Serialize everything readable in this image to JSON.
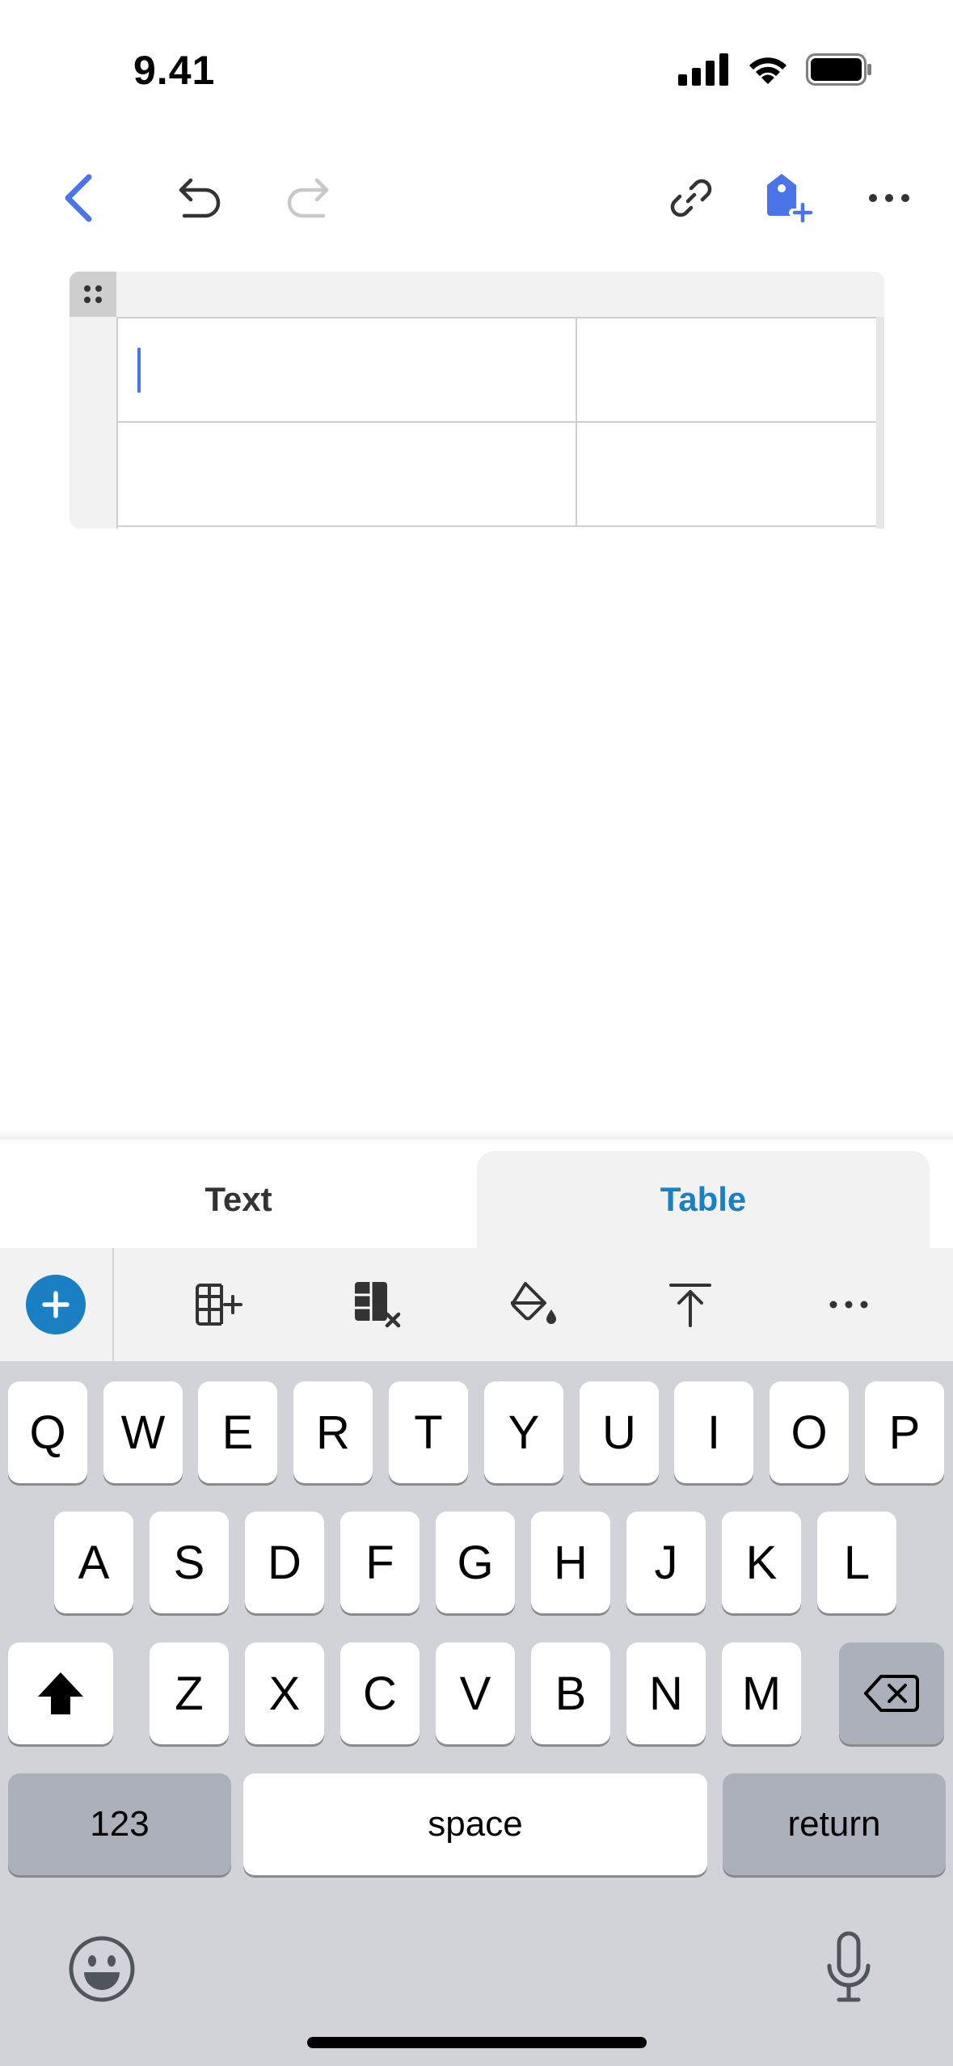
{
  "status": {
    "time": "9.41"
  },
  "toolbar": {
    "back_icon": "chevron-left-icon",
    "undo_icon": "undo-icon",
    "redo_icon": "redo-icon",
    "link_icon": "link-icon",
    "tag_icon": "tag-add-icon",
    "more_icon": "more-horizontal-icon"
  },
  "table": {
    "rows": [
      [
        "",
        ""
      ],
      [
        "",
        ""
      ]
    ]
  },
  "panel": {
    "tabs": [
      {
        "label": "Text",
        "active": false
      },
      {
        "label": "Table",
        "active": true
      }
    ],
    "tools": [
      "add-icon",
      "insert-column-icon",
      "delete-column-icon",
      "fill-color-icon",
      "align-top-icon",
      "more-icon"
    ]
  },
  "keyboard": {
    "row1": [
      "Q",
      "W",
      "E",
      "R",
      "T",
      "Y",
      "U",
      "I",
      "O",
      "P"
    ],
    "row2": [
      "A",
      "S",
      "D",
      "F",
      "G",
      "H",
      "J",
      "K",
      "L"
    ],
    "row3": [
      "Z",
      "X",
      "C",
      "V",
      "B",
      "N",
      "M"
    ],
    "numbers_label": "123",
    "space_label": "space",
    "return_label": "return"
  },
  "colors": {
    "accent": "#4b74e8",
    "table_accent": "#1a7fc3"
  }
}
